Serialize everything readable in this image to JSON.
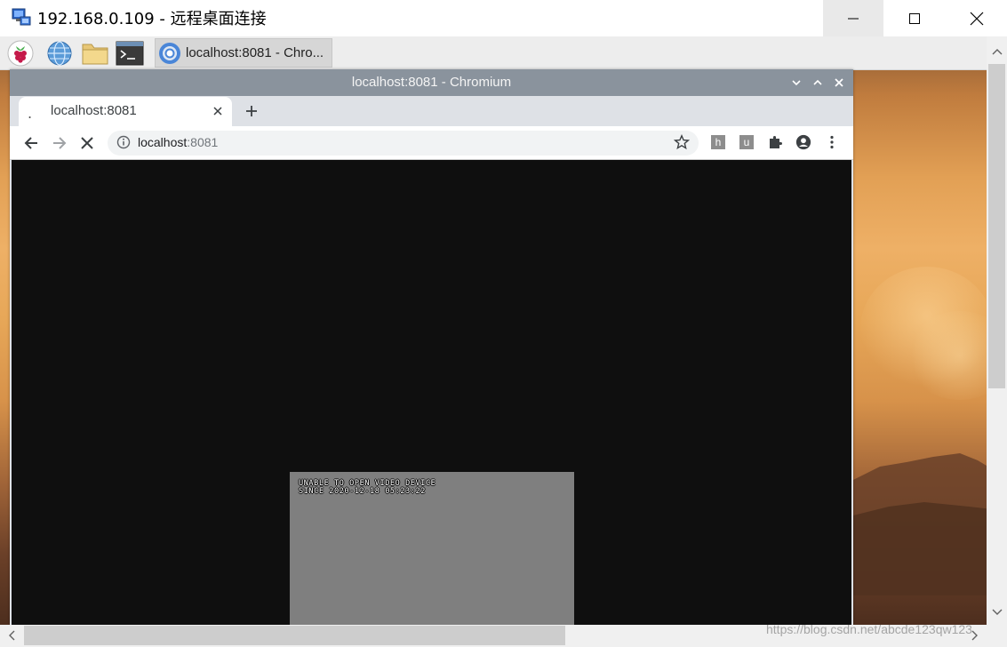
{
  "rdp": {
    "title": "192.168.0.109 - 远程桌面连接"
  },
  "taskbar": {
    "launchers": [
      "raspberry-menu",
      "web-browser",
      "file-manager",
      "terminal"
    ],
    "task_label": "localhost:8081 - Chro..."
  },
  "chromium": {
    "window_title": "localhost:8081 - Chromium",
    "tab_title": "localhost:8081",
    "tab_loading_glyph": ".",
    "omnibox": {
      "host": "localhost",
      "port": ":8081"
    },
    "extensions": [
      {
        "name": "extension-h",
        "letter": "h"
      },
      {
        "name": "extension-u",
        "letter": "u"
      }
    ]
  },
  "page": {
    "video_message": "UNABLE TO OPEN VIDEO DEVICE\nSINCE 2020-12-18 05:23:22"
  },
  "watermark": "https://blog.csdn.net/abcde123qw123",
  "colors": {
    "page_background": "#0f0f0f",
    "video_box": "#7f7f7f",
    "chromium_titlebar": "#8a939d"
  }
}
